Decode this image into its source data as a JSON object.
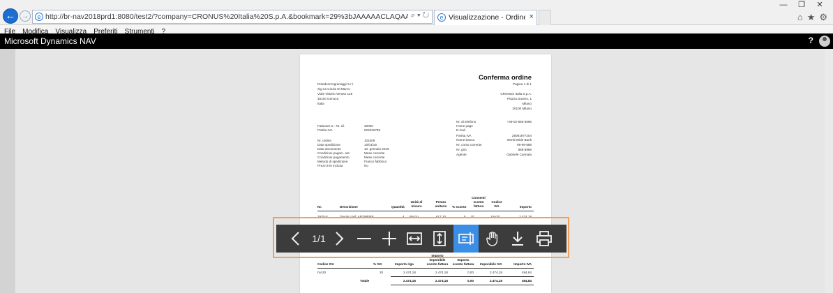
{
  "browser": {
    "url": "http://br-nav2018prd1:8080/test2/?company=CRONUS%20Italia%20S.p.A.&bookmark=29%3bJAAAAACLAQAAAJ7BjEAMAAxADAAMAA1&page=42&dc=0",
    "tab_title": "Visualizzazione - Ordine ve...",
    "tab_close": "×",
    "window_controls": [
      "—",
      "❐",
      "✕"
    ]
  },
  "menu": {
    "items": [
      "File",
      "Modifica",
      "Visualizza",
      "Preferiti",
      "Strumenti",
      "?"
    ]
  },
  "app": {
    "title": "Microsoft Dynamics NAV",
    "help": "?"
  },
  "document": {
    "title": "Conferma ordine",
    "page_label": "Pagina 1 di 1",
    "sender": [
      "Rotadent Ingranaggi S.r.l.",
      "Sig.na Cinzia Di Marco",
      "Viale Vittorio Veneto 125",
      "16100 Genova",
      "Italia"
    ],
    "recipient": [
      "CRONUS Italia S.p.A.",
      "Piazza Duomo, 1",
      "Milano",
      "20100 Milano"
    ],
    "bill_label": "Fatturare a - Nr. cli.",
    "bill_value": "30000",
    "vat_label": "Partita IVA",
    "vat_value": "523432788",
    "order_fields": [
      {
        "label": "Nr. ordine",
        "value": "101009"
      },
      {
        "label": "Data spedizione",
        "value": "10/01/19"
      },
      {
        "label": "Data documento",
        "value": "10. gennaio 2019"
      },
      {
        "label": "Condizioni pagam. ant.",
        "value": "Mese corrente"
      },
      {
        "label": "Condizioni pagamento",
        "value": "Mese corrente"
      },
      {
        "label": "Metodo di spedizione",
        "value": "Franco fabbrica"
      },
      {
        "label": "Prezzi IVA inclusa",
        "value": "No"
      }
    ],
    "company_fields": [
      {
        "label": "Nr. di telefono",
        "value": "+39-02-666-6666"
      },
      {
        "label": "Home page",
        "value": ""
      },
      {
        "label": "E-mail",
        "value": ""
      },
      {
        "label": "Partita IVA",
        "value": "28091977204"
      },
      {
        "label": "Nome banca",
        "value": "World Wide Bank"
      },
      {
        "label": "Nr. conto corrente",
        "value": "99-99-888"
      },
      {
        "label": "Nr. giro",
        "value": "888-8888"
      },
      {
        "label": "Agente",
        "value": "Gabriele Cannata"
      }
    ],
    "lines_header": [
      "Nr.",
      "Descrizione",
      "Quantità",
      "Unità di misura",
      "Prezzo unitario",
      "% sconto",
      "Consenti sconto fattura",
      "Codice IVA",
      "Importo"
    ],
    "line": [
      "1920-S",
      "Tavolo conf. ANTWERP",
      "4",
      "Pezzo",
      "617,10",
      "5",
      "Sì",
      "IVA20",
      "2.474,18"
    ],
    "vat_header": [
      "Codice IVA",
      "% IVA",
      "Importo riga",
      "Importo imponibile sconto fattura",
      "Importo sconto fattura",
      "Imponibile IVA",
      "Importo IVA"
    ],
    "vat_row": [
      "IVA20",
      "20",
      "2.474,18",
      "2.474,18",
      "0,00",
      "2.474,18",
      "494,84"
    ],
    "total_row": [
      "Totale",
      "2.474,18",
      "2.474,18",
      "0,00",
      "2.474,18",
      "494,84"
    ]
  },
  "toolbar": {
    "page_indicator": "1/1",
    "icons": [
      "chevron-left-icon",
      "chevron-right-icon",
      "zoom-out-icon",
      "zoom-in-icon",
      "fit-width-icon",
      "fit-page-icon",
      "select-text-icon",
      "hand-pan-icon",
      "download-icon",
      "print-icon"
    ],
    "active": "select-text-icon"
  }
}
